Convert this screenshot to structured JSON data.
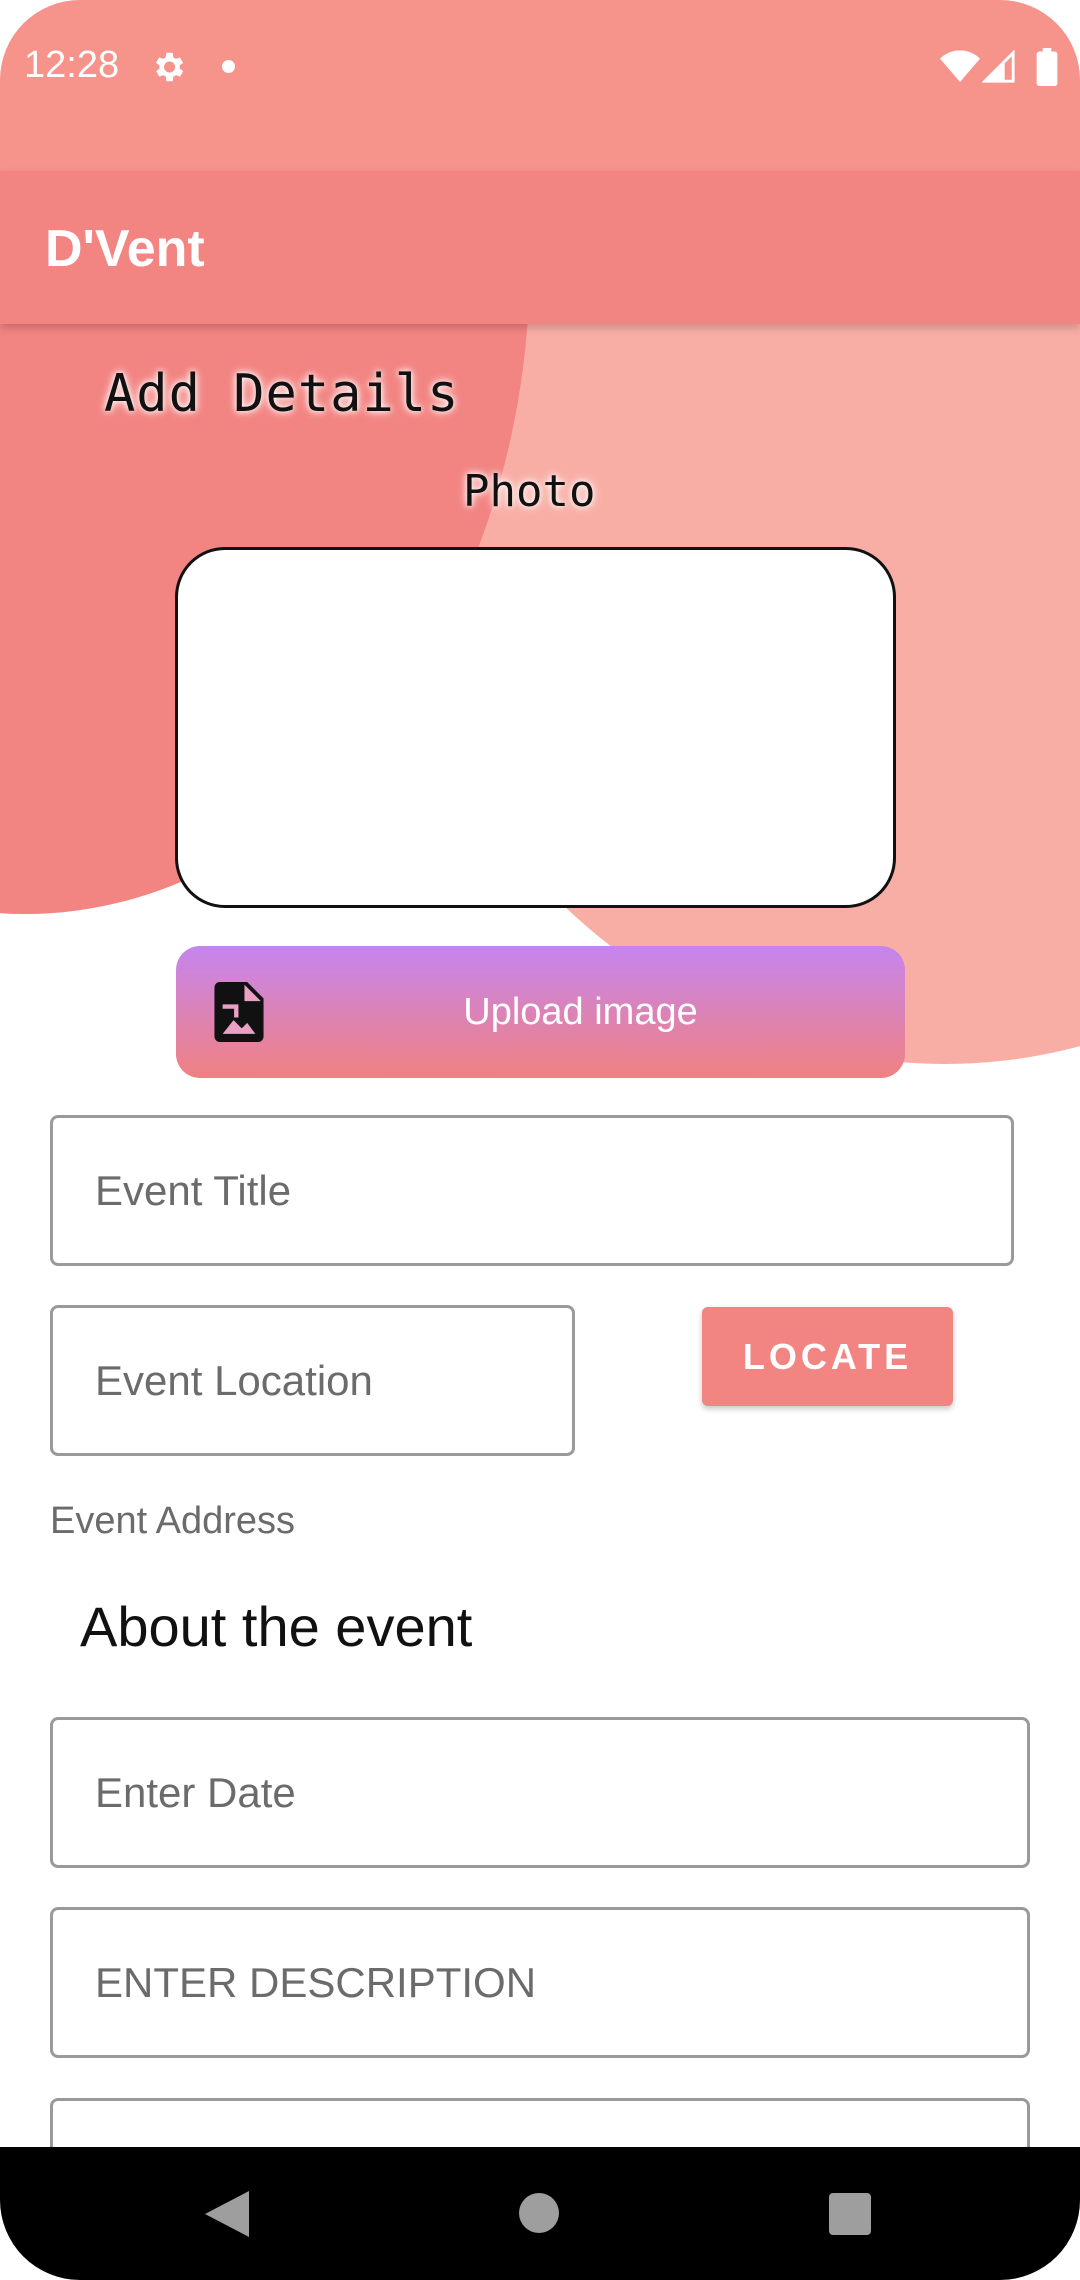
{
  "status_bar": {
    "time": "12:28",
    "icons": [
      "gear-icon",
      "dot-icon",
      "wifi-icon",
      "signal-icon",
      "battery-icon"
    ]
  },
  "app_bar": {
    "title": "D'Vent"
  },
  "form": {
    "heading": "Add Details",
    "photo_label": "Photo",
    "upload_button": {
      "label": "Upload image",
      "icon": "image-file-icon"
    },
    "event_title": {
      "placeholder": "Event Title",
      "value": ""
    },
    "event_location": {
      "placeholder": "Event Location",
      "value": ""
    },
    "locate_button": "LOCATE",
    "event_address_label": "Event Address",
    "about_heading": "About the event",
    "enter_date": {
      "placeholder": "Enter Date",
      "value": ""
    },
    "enter_description": {
      "placeholder": "ENTER DESCRIPTION",
      "value": ""
    }
  },
  "nav_bar": {
    "icons": [
      "back-icon",
      "home-icon",
      "recents-icon"
    ]
  },
  "colors": {
    "status_bar": "#f6938a",
    "app_bar": "#f28482",
    "blob_light": "#f8aea5",
    "blob_dark": "#f28482",
    "upload_gradient_top": "#c585ee",
    "upload_gradient_bottom": "#f08181",
    "locate_button": "#f28482"
  }
}
